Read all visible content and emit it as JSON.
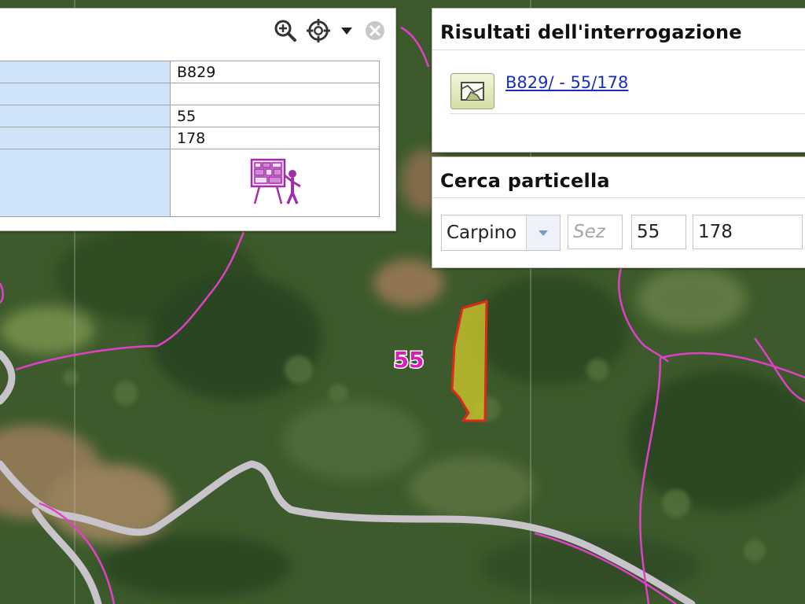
{
  "map": {
    "parcel_label": "55"
  },
  "identify_panel": {
    "rows": [
      {
        "value": "B829"
      },
      {
        "value": ""
      },
      {
        "value": "55"
      },
      {
        "value": "178"
      }
    ],
    "tools": [
      "zoom-in-icon",
      "crosshair-target-icon",
      "caret-down-icon",
      "close-circle-icon"
    ]
  },
  "results": {
    "title": "Risultati dell'interrogazione",
    "item_label": "B829/ - 55/178"
  },
  "search": {
    "title": "Cerca particella",
    "comune": "Carpino",
    "sezione_placeholder": "Sez",
    "sezione": "",
    "foglio": "55",
    "particella": "178"
  },
  "colors": {
    "boundary": "#e040c8",
    "road": "#c9c4cc",
    "parcel_fill": "#c9c62a",
    "parcel_outline": "#e0281a",
    "label": "#d81fb5",
    "table_key_bg": "#cfe3f8",
    "link": "#1a2fb3"
  }
}
